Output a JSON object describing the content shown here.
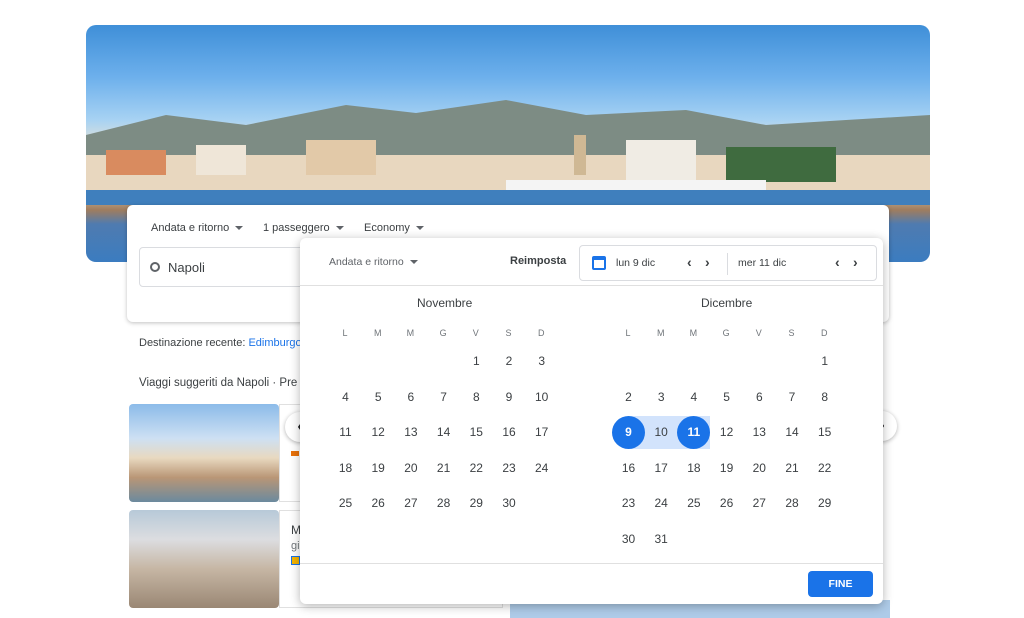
{
  "search": {
    "trip_type": "Andata e ritorno",
    "passengers": "1 passeggero",
    "cabin_class": "Economy",
    "origin": "Napoli"
  },
  "recent": {
    "label": "Destinazione recente:",
    "link": "Edimburgo"
  },
  "suggestions": {
    "heading": "Viaggi suggeriti da Napoli · Pre",
    "card2_title": "M",
    "card2_sub": "gi"
  },
  "picker": {
    "trip_type": "Andata e ritorno",
    "reset_label": "Reimposta",
    "depart_date": "lun 9 dic",
    "return_date": "mer 11 dic",
    "done_label": "FINE",
    "weekdays": [
      "L",
      "M",
      "M",
      "G",
      "V",
      "S",
      "D"
    ],
    "months": [
      {
        "title": "Novembre",
        "weeks": [
          [
            "",
            "",
            "",
            "",
            "1",
            "2",
            "3"
          ],
          [
            "4",
            "5",
            "6",
            "7",
            "8",
            "9",
            "10"
          ],
          [
            "11",
            "12",
            "13",
            "14",
            "15",
            "16",
            "17"
          ],
          [
            "18",
            "19",
            "20",
            "21",
            "22",
            "23",
            "24"
          ],
          [
            "25",
            "26",
            "27",
            "28",
            "29",
            "30",
            ""
          ]
        ]
      },
      {
        "title": "Dicembre",
        "weeks": [
          [
            "",
            "",
            "",
            "",
            "",
            "",
            "1"
          ],
          [
            "2",
            "3",
            "4",
            "5",
            "6",
            "7",
            "8"
          ],
          [
            "9",
            "10",
            "11",
            "12",
            "13",
            "14",
            "15"
          ],
          [
            "16",
            "17",
            "18",
            "19",
            "20",
            "21",
            "22"
          ],
          [
            "23",
            "24",
            "25",
            "26",
            "27",
            "28",
            "29"
          ],
          [
            "30",
            "31",
            "",
            "",
            "",
            "",
            ""
          ]
        ]
      }
    ],
    "selected_start": "9",
    "selected_end": "11"
  },
  "icons": {
    "prev": "‹",
    "next": "›",
    "nav_prev": "‹",
    "nav_next": "›"
  },
  "colors": {
    "accent": "#1a73e8",
    "range": "#d2e3fc"
  }
}
